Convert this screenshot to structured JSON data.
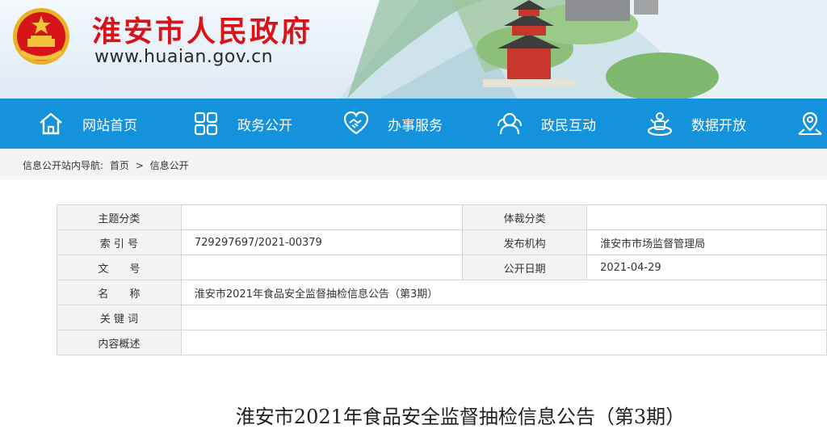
{
  "header": {
    "site_title": "淮安市人民政府",
    "site_url": "www.huaian.gov.cn"
  },
  "nav": {
    "items": [
      {
        "label": "网站首页",
        "icon": "home-icon"
      },
      {
        "label": "政务公开",
        "icon": "grid-icon"
      },
      {
        "label": "办事服务",
        "icon": "handshake-icon"
      },
      {
        "label": "政民互动",
        "icon": "people-icon"
      },
      {
        "label": "数据开放",
        "icon": "data-icon"
      },
      {
        "label": "",
        "icon": "map-icon"
      }
    ]
  },
  "breadcrumb": {
    "prefix": "信息公开站内导航:",
    "home": "首页",
    "separator": ">",
    "current": "信息公开"
  },
  "info": {
    "topic_label": "主题分类",
    "topic_value": "",
    "genre_label": "体裁分类",
    "genre_value": "",
    "index_label": "索 引 号",
    "index_value": "729297697/2021-00379",
    "publisher_label": "发布机构",
    "publisher_value": "淮安市市场监督管理局",
    "docno_label": "文　　号",
    "docno_value": "",
    "date_label": "公开日期",
    "date_value": "2021-04-29",
    "name_label": "名　　称",
    "name_value": "淮安市2021年食品安全监督抽检信息公告（第3期）",
    "keyword_label": "关 键 词",
    "keyword_value": "",
    "summary_label": "内容概述",
    "summary_value": ""
  },
  "article": {
    "title": "淮安市2021年食品安全监督抽检信息公告（第3期）"
  },
  "colors": {
    "title_red": "#d8141b",
    "nav_blue": "#1592dc"
  }
}
